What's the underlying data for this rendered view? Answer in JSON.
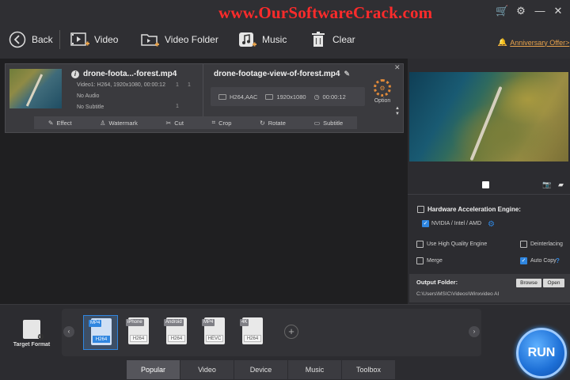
{
  "watermark": "www.OurSoftwareCrack.com",
  "window_icons": {
    "cart": "cart-icon",
    "settings": "gear-icon",
    "minimize": "minimize-icon",
    "close": "close-icon"
  },
  "toolbar": {
    "back": "Back",
    "video": "Video",
    "video_folder": "Video Folder",
    "music": "Music",
    "clear": "Clear",
    "anniversary": "Anniversary Offer>"
  },
  "file": {
    "source_name": "drone-foota...-forest.mp4",
    "source_video": "Video1: H264, 1920x1080, 00:00:12",
    "source_audio": "No Audio",
    "source_subtitle": "No Subtitle",
    "nums": [
      "1",
      "1",
      "1"
    ],
    "output_name": "drone-footage-view-of-forest.mp4",
    "output_codec": "H264,AAC",
    "output_resolution": "1920x1080",
    "output_duration": "00:00:12",
    "option_label": "Option"
  },
  "edit_tools": [
    {
      "label": "Effect",
      "icon": "effect-icon",
      "glyph": "✎"
    },
    {
      "label": "Watermark",
      "icon": "watermark-icon",
      "glyph": "♙"
    },
    {
      "label": "Cut",
      "icon": "scissors-icon",
      "glyph": "✂"
    },
    {
      "label": "Crop",
      "icon": "crop-icon",
      "glyph": "⌗"
    },
    {
      "label": "Rotate",
      "icon": "rotate-icon",
      "glyph": "↻"
    },
    {
      "label": "Subtitle",
      "icon": "subtitle-icon",
      "glyph": "▭"
    }
  ],
  "settings": {
    "hardware_accel": "Hardware Acceleration Engine:",
    "nvidia": "NVIDIA / Intel / AMD",
    "high_quality": "Use High Quality Engine",
    "deinterlacing": "Deinterlacing",
    "merge": "Merge",
    "auto_copy": "Auto Copy",
    "help": "?"
  },
  "output": {
    "title": "Output Folder:",
    "path": "C:\\Users\\MSIC\\Videos\\Winxvideo AI",
    "browse": "Browse",
    "open": "Open"
  },
  "target_format": "Target Format",
  "presets": [
    {
      "top": "MP4",
      "bottom": "H264",
      "selected": true
    },
    {
      "top": "iPhone",
      "bottom": "H264",
      "selected": false
    },
    {
      "top": "Android",
      "bottom": "H264",
      "selected": false
    },
    {
      "top": "MP4",
      "bottom": "HEVC",
      "selected": false
    },
    {
      "top": "4K",
      "bottom": "H264",
      "selected": false
    }
  ],
  "tabs": [
    "Popular",
    "Video",
    "Device",
    "Music",
    "Toolbox"
  ],
  "run": "RUN",
  "colors": {
    "accent": "#2f86e0",
    "watermark": "#ff2b2b",
    "option": "#e08a3a"
  }
}
